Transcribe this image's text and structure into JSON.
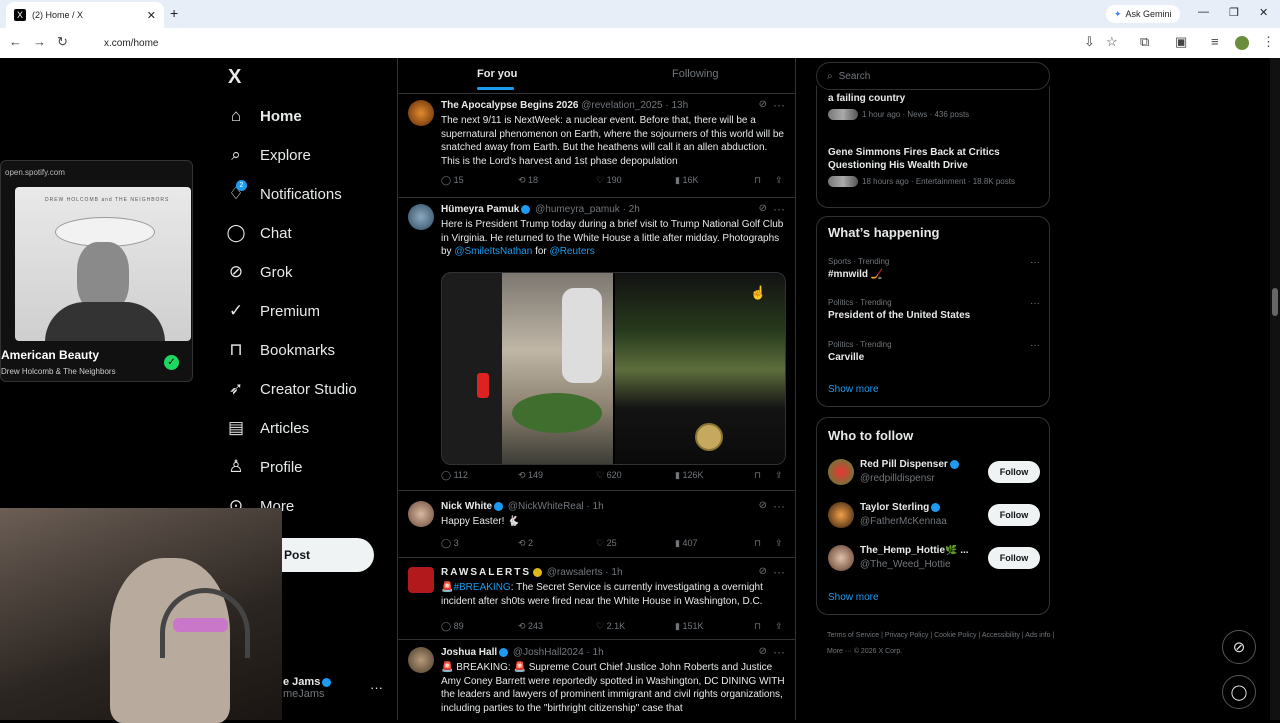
{
  "browser": {
    "tab_title": "(2) Home / X",
    "tab_favicon": "X",
    "url": "x.com/home",
    "gemini_label": "Ask Gemini"
  },
  "nav": {
    "logo": "X",
    "items": [
      {
        "label": "Home",
        "icon": "home-icon"
      },
      {
        "label": "Explore",
        "icon": "search-icon"
      },
      {
        "label": "Notifications",
        "icon": "bell-icon",
        "badge": "2"
      },
      {
        "label": "Chat",
        "icon": "chat-icon"
      },
      {
        "label": "Grok",
        "icon": "grok-icon"
      },
      {
        "label": "Premium",
        "icon": "premium-icon"
      },
      {
        "label": "Bookmarks",
        "icon": "bookmark-icon"
      },
      {
        "label": "Creator Studio",
        "icon": "rocket-icon"
      },
      {
        "label": "Articles",
        "icon": "articles-icon"
      },
      {
        "label": "Profile",
        "icon": "profile-icon"
      },
      {
        "label": "More",
        "icon": "more-icon"
      }
    ],
    "post_label": "Post",
    "account_name": "e Jams",
    "account_handle": "meJams"
  },
  "spotify": {
    "source": "open.spotify.com",
    "art_text": "DREW HOLCOMB and THE NEIGHBORS",
    "song": "American Beauty",
    "artist": "Drew Holcomb & The Neighbors"
  },
  "feed": {
    "tabs": [
      "For you",
      "Following"
    ],
    "tweets": [
      {
        "name": "The Apocalypse Begins 2026",
        "handle": "@revelation_2025 · 13h",
        "text": "The next 9/11 is NextWeek: a nuclear event. Before that, there will be a supernatural phenomenon on Earth, where the sojourners of this world will be snatched away from Earth. But the heathens will call it an allen abduction. This is the Lord's harvest and 1st phase depopulation",
        "replies": "15",
        "reposts": "18",
        "likes": "190",
        "views": "16K"
      },
      {
        "name": "Hümeyra Pamuk",
        "handle": "@humeyra_pamuk · 2h",
        "text": "Here is President Trump today during a brief visit to Trump National Golf Club in Virginia. He returned to the White House a little after midday. Photographs by",
        "link1": "@SmileItsNathan",
        "mid": "for",
        "link2": "@Reuters",
        "replies": "112",
        "reposts": "149",
        "likes": "620",
        "views": "126K"
      },
      {
        "name": "Nick White",
        "handle": "@NickWhiteReal · 1h",
        "text": "Happy Easter! 🐇",
        "replies": "3",
        "reposts": "2",
        "likes": "25",
        "views": "407"
      },
      {
        "name": "RAWSALERTS",
        "handle": "@rawsalerts · 1h",
        "prefix": "🚨",
        "hashtag": "#BREAKING",
        "text": ": The Secret Service is currently investigating a overnight incident after sh0ts were fired near the White House in Washington, D.C.",
        "replies": "89",
        "reposts": "243",
        "likes": "2.1K",
        "views": "151K"
      },
      {
        "name": "Joshua Hall",
        "handle": "@JoshHall2024 · 1h",
        "text": "🚨 BREAKING: 🚨 Supreme Court Chief Justice John Roberts and Justice Amy Coney Barrett were reportedly spotted in Washington, DC DINING WITH the leaders and lawyers of prominent immigrant and civil rights organizations, including parties to the \"birthright citizenship\" case that"
      }
    ]
  },
  "sidebar": {
    "search_placeholder": "Search",
    "news": [
      {
        "title": "a failing country",
        "meta": "1 hour ago · News · 436 posts"
      },
      {
        "title": "Gene Simmons Fires Back at Critics Questioning His Wealth Drive",
        "meta": "18 hours ago · Entertainment · 18.8K posts"
      }
    ],
    "happening_title": "What’s happening",
    "trends": [
      {
        "cat": "Sports · Trending",
        "title": "#mnwild 🏒"
      },
      {
        "cat": "Politics · Trending",
        "title": "President of the United States"
      },
      {
        "cat": "Politics · Trending",
        "title": "Carville"
      }
    ],
    "show_more": "Show more",
    "wtf_title": "Who to follow",
    "follow": [
      {
        "name": "Red Pill Dispenser",
        "handle": "@redpilldispensr"
      },
      {
        "name": "Taylor Sterling",
        "handle": "@FatherMcKennaa"
      },
      {
        "name": "The_Hemp_Hottie🌿 ...",
        "handle": "@The_Weed_Hottie"
      }
    ],
    "follow_label": "Follow",
    "footer": "Terms of Service  |  Privacy Policy  |  Cookie Policy  |  Accessibility  |  Ads info  |  More ···  © 2026 X Corp."
  }
}
